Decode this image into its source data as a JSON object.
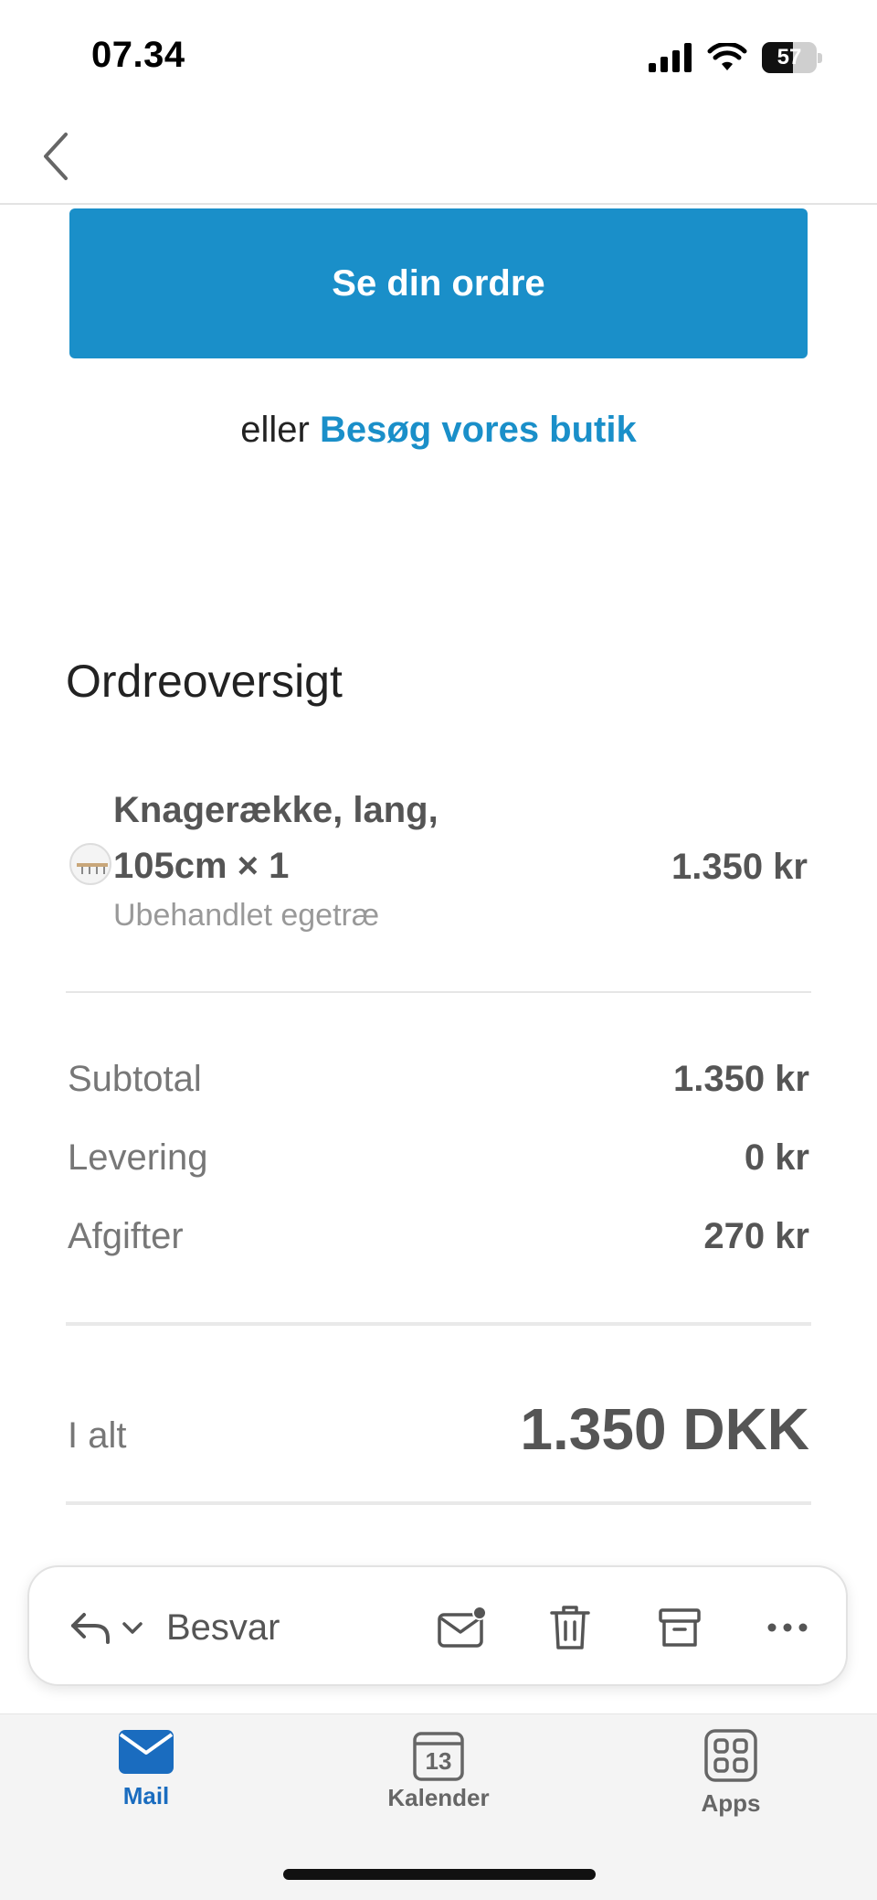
{
  "status_bar": {
    "time": "07.34",
    "battery_level": "57",
    "battery_fraction": 0.57
  },
  "email": {
    "cta_button": "Se din ordre",
    "alt_prefix": "eller ",
    "alt_link": "Besøg vores butik",
    "section_title": "Ordreoversigt",
    "item": {
      "title": "Knagerække, lang, 105cm × 1",
      "variant": "Ubehandlet egetræ",
      "price": "1.350 kr"
    },
    "summary": [
      {
        "label": "Subtotal",
        "value": "1.350 kr"
      },
      {
        "label": "Levering",
        "value": "0 kr"
      },
      {
        "label": "Afgifter",
        "value": "270 kr"
      }
    ],
    "total": {
      "label": "I alt",
      "value": "1.350 DKK"
    }
  },
  "toolbar": {
    "reply_label": "Besvar",
    "icons": [
      "reply-icon",
      "chevron-down-icon",
      "mark-unread-icon",
      "trash-icon",
      "archive-icon",
      "more-icon"
    ]
  },
  "tab_bar": {
    "tabs": [
      {
        "label": "Mail",
        "icon": "mail-icon",
        "active": true
      },
      {
        "label": "Kalender",
        "icon": "calendar-icon",
        "date": "13",
        "active": false
      },
      {
        "label": "Apps",
        "icon": "apps-icon",
        "active": false
      }
    ]
  },
  "colors": {
    "accent": "#1a8fc9",
    "tab_active": "#1a6cbf"
  }
}
